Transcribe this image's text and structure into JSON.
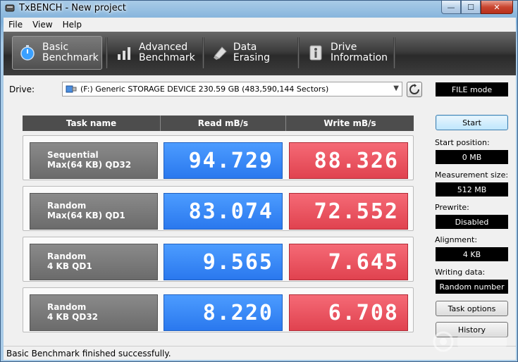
{
  "window": {
    "title": "TxBENCH - New project"
  },
  "caption": {
    "minimize": "—",
    "maximize": "☐",
    "close": "✕"
  },
  "menu": [
    "File",
    "View",
    "Help"
  ],
  "tabs": [
    {
      "label": "Basic\nBenchmark",
      "icon": "stopwatch-icon",
      "active": true
    },
    {
      "label": "Advanced\nBenchmark",
      "icon": "bar-chart-icon",
      "active": false
    },
    {
      "label": "Data Erasing",
      "icon": "erase-icon",
      "active": false
    },
    {
      "label": "Drive\nInformation",
      "icon": "info-icon",
      "active": false
    }
  ],
  "drive": {
    "label": "Drive:",
    "selected": "(F:) Generic STORAGE DEVICE  230.59 GB (483,590,144 Sectors)"
  },
  "mode": "FILE mode",
  "table": {
    "headers": [
      "Task name",
      "Read mB/s",
      "Write mB/s"
    ],
    "rows": [
      {
        "task": "Sequential\nMax(64 KB) QD32",
        "read": "94.729",
        "write": "88.326"
      },
      {
        "task": "Random\nMax(64 KB) QD1",
        "read": "83.074",
        "write": "72.552"
      },
      {
        "task": "Random\n4 KB QD1",
        "read": "9.565",
        "write": "7.645"
      },
      {
        "task": "Random\n4 KB QD32",
        "read": "8.220",
        "write": "6.708"
      }
    ]
  },
  "side": {
    "start_label": "Start",
    "start_position_label": "Start position:",
    "start_position": "0 MB",
    "measurement_size_label": "Measurement size:",
    "measurement_size": "512 MB",
    "prewrite_label": "Prewrite:",
    "prewrite": "Disabled",
    "alignment_label": "Alignment:",
    "alignment": "4 KB",
    "writing_data_label": "Writing data:",
    "writing_data": "Random number",
    "task_options_label": "Task options",
    "history_label": "History"
  },
  "status": "Basic Benchmark finished successfully.",
  "colors": {
    "read": "#2a78ee",
    "write": "#e0424f"
  }
}
